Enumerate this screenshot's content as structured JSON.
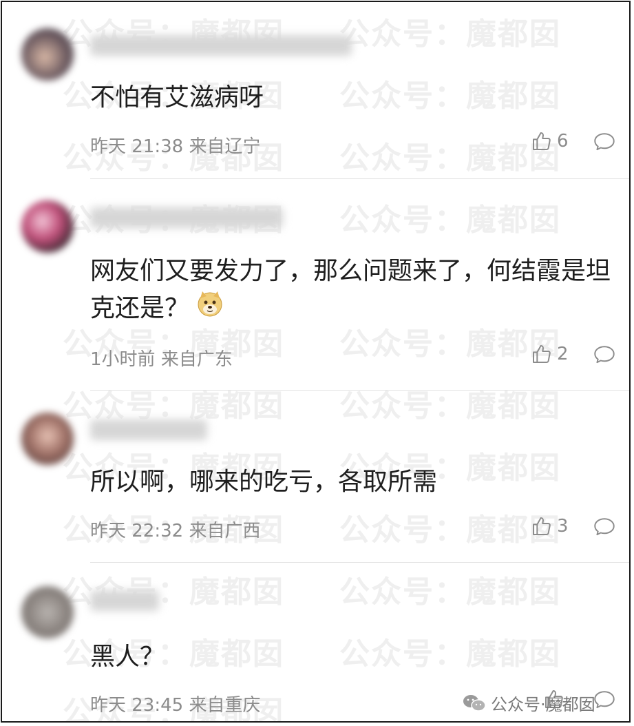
{
  "watermark_text": "公众号：魔都囡",
  "comments": [
    {
      "username": "",
      "text": "不怕有艾滋病呀",
      "time": "昨天 21:38",
      "location": "来自辽宁",
      "likes": "6"
    },
    {
      "username": "",
      "text": "网友们又要发力了，那么问题来了，何结霞是坦克还是？",
      "time": "1小时前",
      "location": "来自广东",
      "likes": "2"
    },
    {
      "username": "",
      "text": "所以啊，哪来的吃亏，各取所需",
      "time": "昨天 22:32",
      "location": "来自广西",
      "likes": "3"
    },
    {
      "username": "",
      "text": "黑人？",
      "time": "昨天 23:45",
      "location": "来自重庆",
      "likes": ""
    }
  ],
  "footer_badge": "公众号·魔都囡",
  "icons": {
    "like": "thumbs-up-icon",
    "reply": "comment-bubble-icon",
    "emoji": "doge-emoji",
    "badge": "wechat-icon"
  },
  "colors": {
    "text": "#1e1e1e",
    "meta": "#8c8c8c",
    "divider": "#e3e3e3",
    "watermark": "#efefef"
  }
}
